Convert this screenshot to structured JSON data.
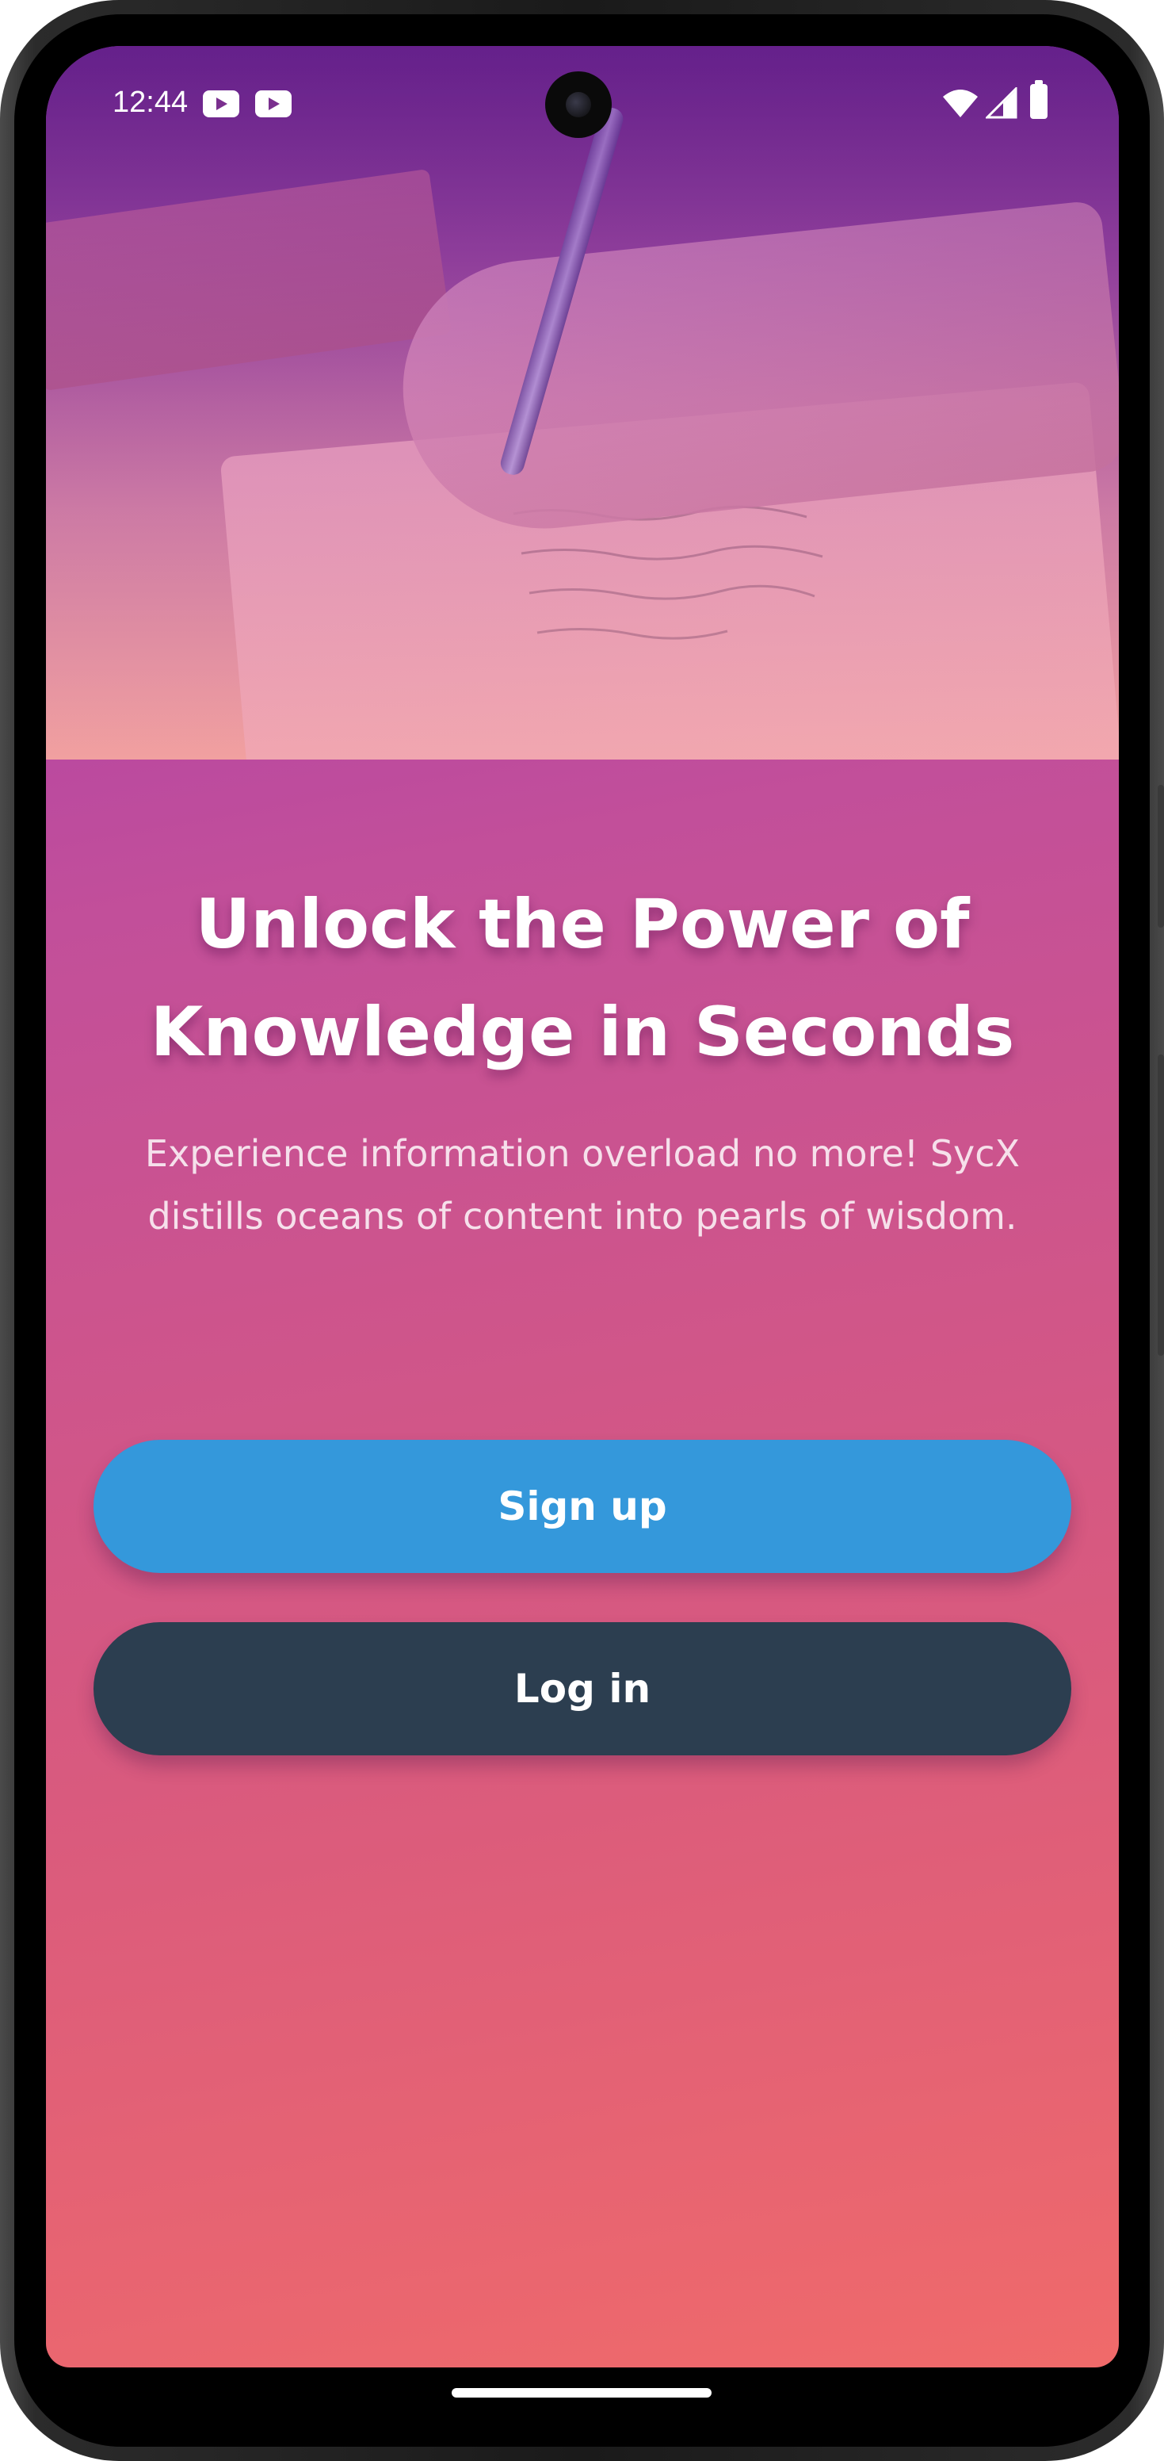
{
  "status_bar": {
    "time": "12:44",
    "notification_icons": [
      "youtube-icon",
      "youtube-icon"
    ],
    "system_icons": [
      "wifi-icon",
      "signal-icon",
      "battery-icon"
    ]
  },
  "hero": {
    "image": "hand-writing-on-paper-photo"
  },
  "main": {
    "headline": "Unlock the Power of Knowledge in Seconds",
    "subtitle": "Experience information overload no more! SycX distills oceans of content into pearls of wisdom."
  },
  "actions": {
    "signup_label": "Sign up",
    "login_label": "Log in"
  },
  "colors": {
    "gradient_top": "#9b33b5",
    "gradient_bottom": "#f06a6a",
    "signup_button": "#3498db",
    "login_button": "#2c3e50",
    "text": "#ffffff"
  }
}
